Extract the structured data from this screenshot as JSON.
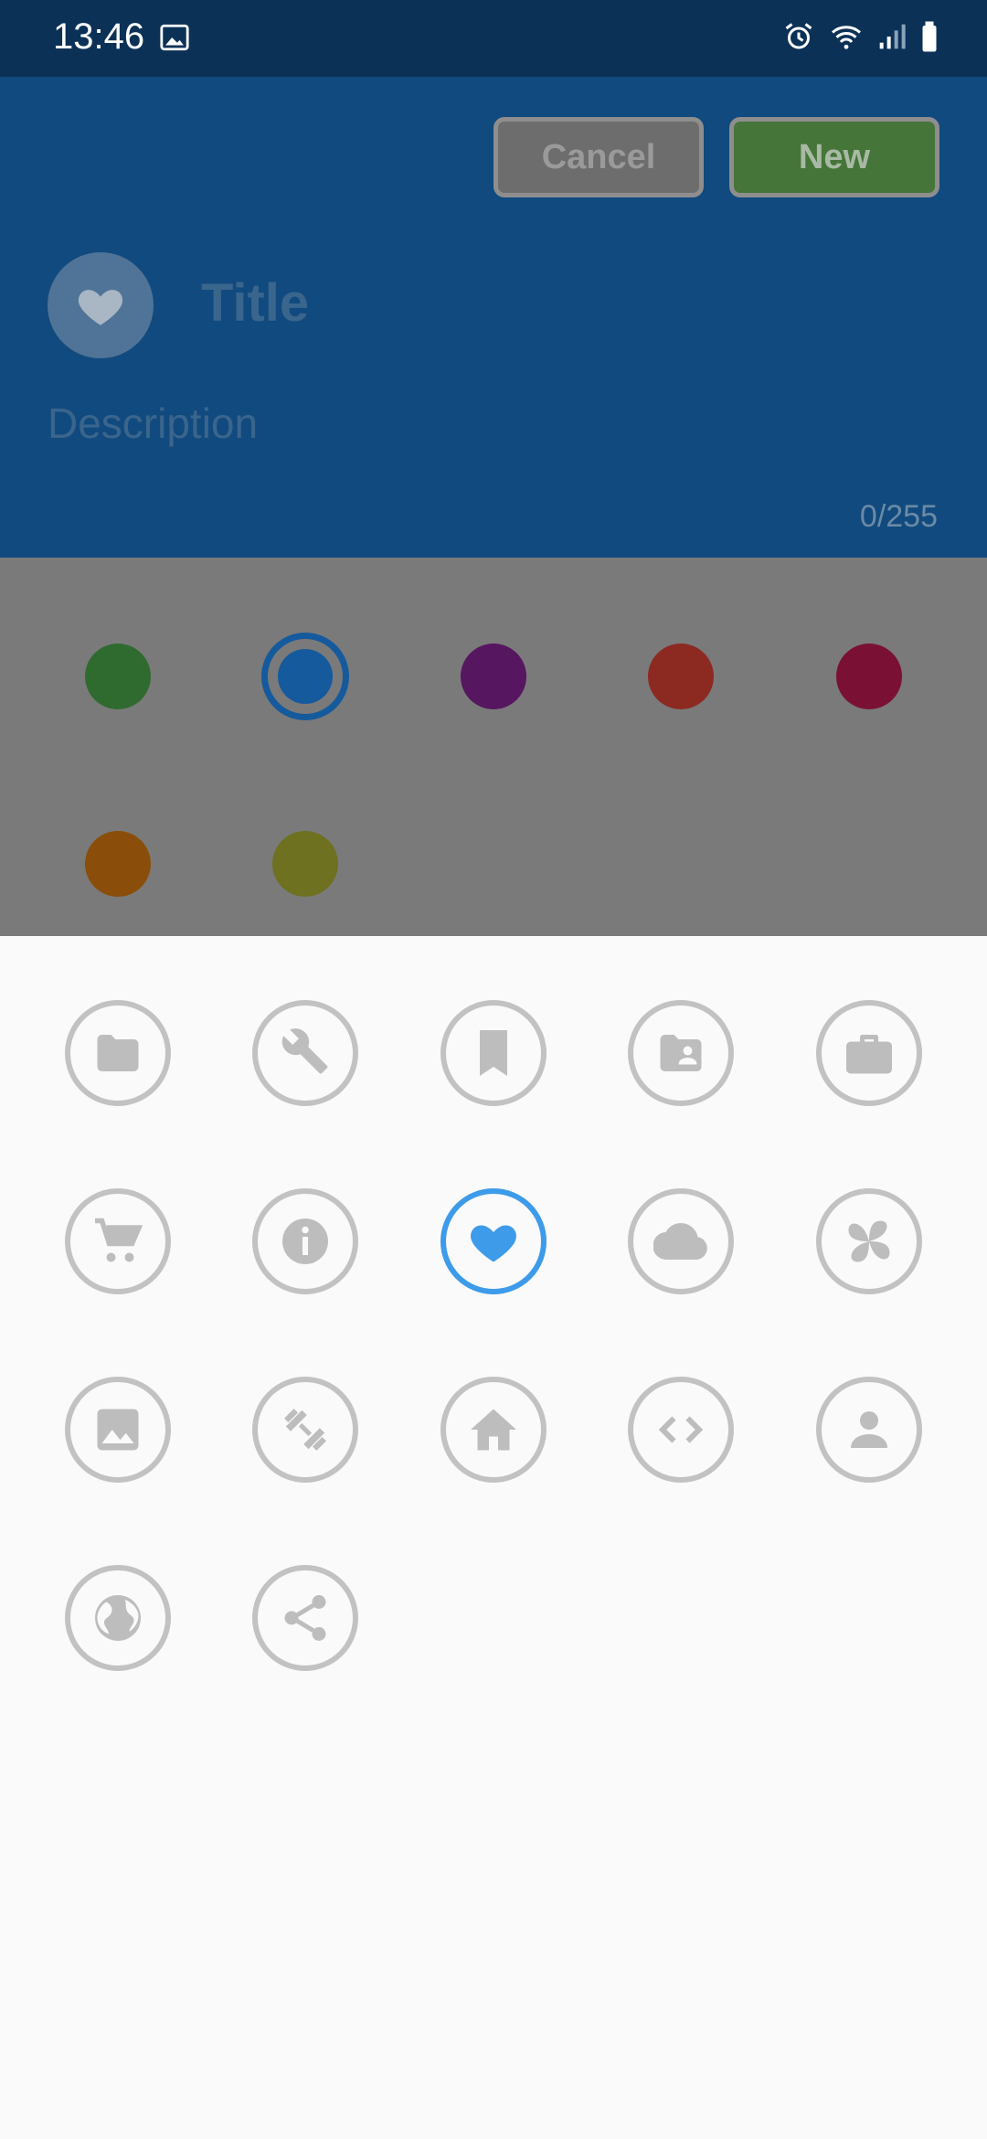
{
  "status_bar": {
    "time": "13:46"
  },
  "header": {
    "cancel_label": "Cancel",
    "new_label": "New",
    "title_placeholder": "Title",
    "description_placeholder": "Description",
    "counter": "0/255"
  },
  "colors": {
    "options": [
      "#2f6b2f",
      "#155a9c",
      "#561660",
      "#8c2a22",
      "#7a1134",
      "#8a4e0a",
      "#6d7120"
    ],
    "selected_index": 1
  },
  "icons": {
    "items": [
      "folder-icon",
      "wrench-icon",
      "bookmark-icon",
      "folder-shared-icon",
      "briefcase-icon",
      "cart-icon",
      "info-icon",
      "heart-icon",
      "cloud-icon",
      "pinwheel-icon",
      "image-icon",
      "dumbbell-icon",
      "home-icon",
      "code-icon",
      "person-icon",
      "globe-icon",
      "share-icon"
    ],
    "selected": "heart-icon",
    "icon_color": "#bdbdbd",
    "selected_color": "#3d9be9"
  }
}
